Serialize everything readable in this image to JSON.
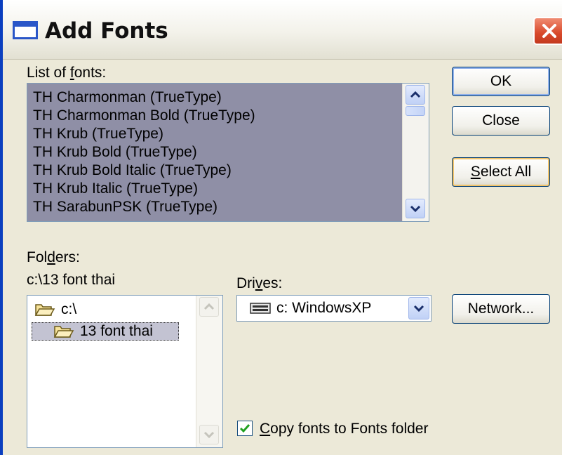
{
  "dialog": {
    "title": "Add Fonts"
  },
  "font_list": {
    "label_prefix": "List of ",
    "label_mnemonic": "f",
    "label_suffix": "onts:",
    "items": [
      "TH Charmonman (TrueType)",
      "TH Charmonman Bold (TrueType)",
      "TH Krub (TrueType)",
      "TH Krub Bold (TrueType)",
      "TH Krub Bold Italic (TrueType)",
      "TH Krub Italic (TrueType)",
      "TH SarabunPSK (TrueType)"
    ]
  },
  "buttons": {
    "ok": "OK",
    "close": "Close",
    "select_all_mnemonic": "S",
    "select_all_rest": "elect All",
    "network": "Network..."
  },
  "folders": {
    "label_prefix": "Fol",
    "label_mnemonic": "d",
    "label_suffix": "ers:",
    "current_path": "c:\\13 font thai",
    "items": [
      {
        "name": "c:\\",
        "icon": "open-folder-icon"
      },
      {
        "name": "13 font thai",
        "icon": "open-folder-icon",
        "selected": true
      }
    ]
  },
  "drives": {
    "label_prefix": "Dri",
    "label_mnemonic": "v",
    "label_suffix": "es:",
    "selected": "c: WindowsXP",
    "icon": "hard-drive-icon"
  },
  "copy_option": {
    "checked": true,
    "label_mnemonic": "C",
    "label_rest": "opy fonts to Fonts folder"
  },
  "colors": {
    "title_bar_border": "#0b3fbf",
    "dialog_bg": "#ece9d8",
    "selection_bg": "#8f8fa6",
    "close_button": "#d8482a",
    "default_button_focus": "#f0c36b",
    "checkmark": "#21a121"
  }
}
